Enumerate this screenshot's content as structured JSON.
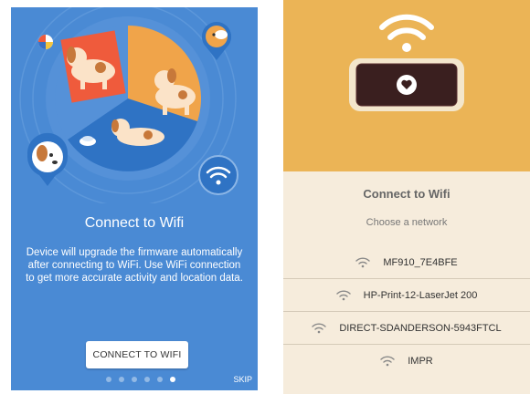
{
  "onboarding": {
    "title": "Connect to Wifi",
    "description": "Device will upgrade the firmware automatically after connecting to WiFi. Use WiFi connection to get more accurate activity and location data.",
    "button_label": "CONNECT TO WIFI",
    "skip_label": "SKIP",
    "page_count": 6,
    "active_page": 6,
    "colors": {
      "background": "#4a8ad4",
      "accent_orange": "#f0a44a",
      "accent_red": "#ef5b3c"
    }
  },
  "wifi_select": {
    "title": "Connect to Wifi",
    "subtitle": "Choose a network",
    "networks": [
      {
        "name": "MF910_7E4BFE",
        "icon": "wifi-icon"
      },
      {
        "name": "HP-Print-12-LaserJet 200",
        "icon": "wifi-icon"
      },
      {
        "name": "DIRECT-SDANDERSON-5943FTCL",
        "icon": "wifi-icon"
      },
      {
        "name": "IMPR",
        "icon": "wifi-icon"
      }
    ],
    "colors": {
      "banner": "#ebb456",
      "background": "#f6ecdc",
      "device": "#3a1f1f"
    }
  }
}
